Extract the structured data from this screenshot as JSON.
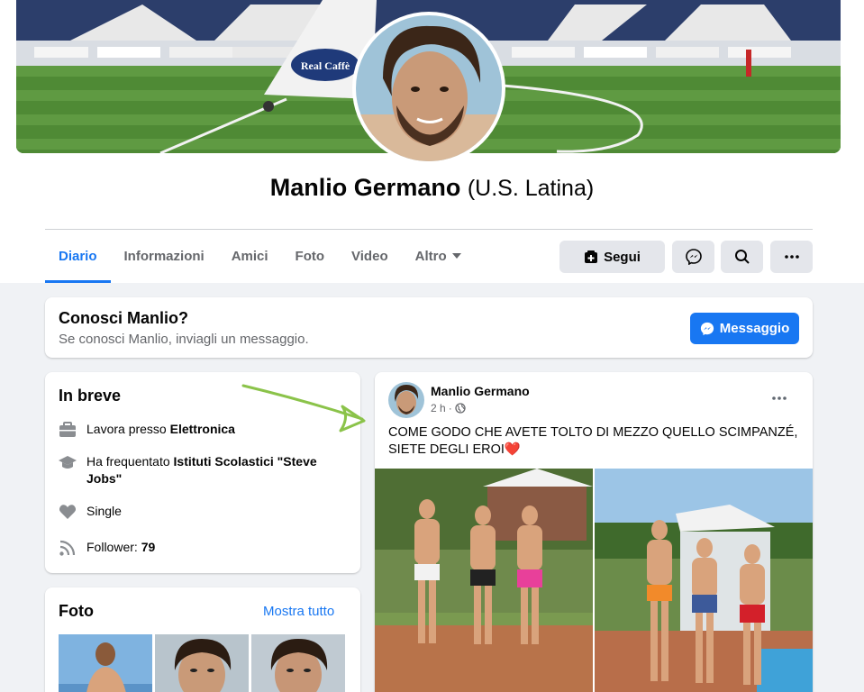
{
  "profile": {
    "name": "Manlio Germano",
    "alt_name": "(U.S. Latina)"
  },
  "tabs": [
    {
      "label": "Diario"
    },
    {
      "label": "Informazioni"
    },
    {
      "label": "Amici"
    },
    {
      "label": "Foto"
    },
    {
      "label": "Video"
    },
    {
      "label": "Altro"
    }
  ],
  "actions": {
    "follow_label": "Segui"
  },
  "know_card": {
    "title": "Conosci Manlio?",
    "subtitle": "Se conosci Manlio, inviagli un messaggio.",
    "message_label": "Messaggio"
  },
  "intro": {
    "title": "In breve",
    "work_prefix": "Lavora presso ",
    "work_place": "Elettronica",
    "study_prefix": "Ha frequentato ",
    "study_place": "Istituti Scolastici \"Steve Jobs\"",
    "relationship": "Single",
    "followers_label": "Follower: ",
    "followers_count": "79"
  },
  "post": {
    "author": "Manlio Germano",
    "time": "2 h",
    "separator": "·",
    "text": "COME GODO CHE AVETE TOLTO DI MEZZO QUELLO SCIMPANZÉ, SIETE DEGLI EROI❤️"
  },
  "photos_section": {
    "title": "Foto",
    "see_all": "Mostra tutto"
  },
  "cover_sign": {
    "line1": "Real Caffè"
  },
  "colors": {
    "accent": "#1877f2",
    "annotation_arrow": "#8bc34a"
  }
}
